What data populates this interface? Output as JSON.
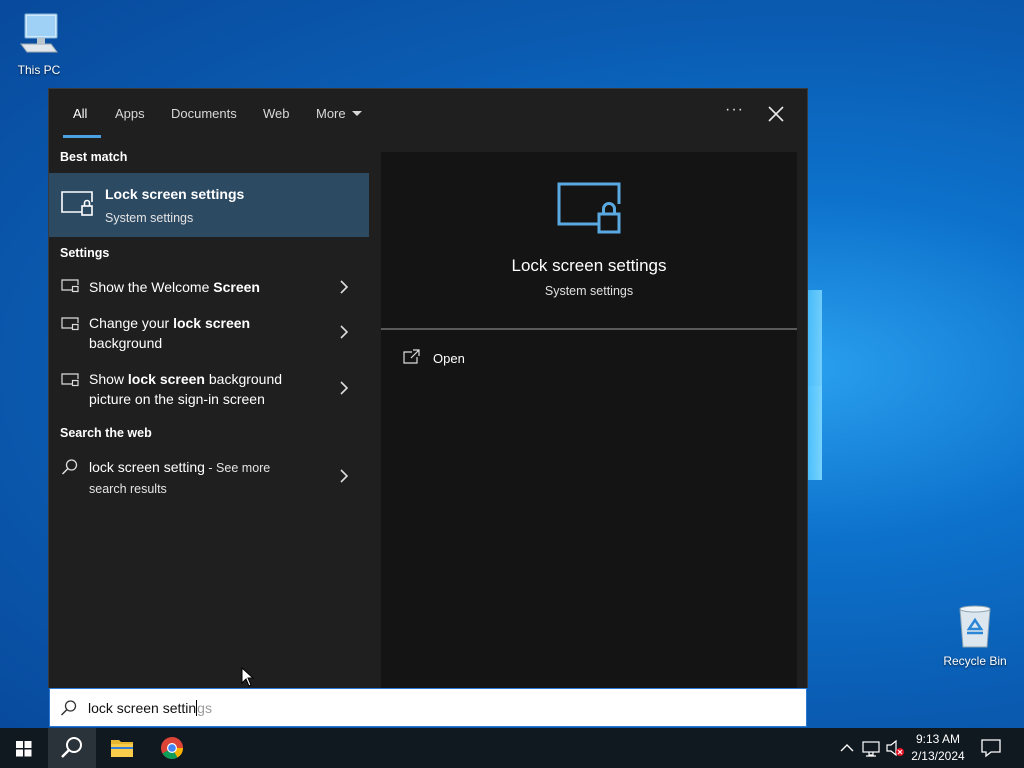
{
  "desktop": {
    "this_pc_label": "This PC",
    "recycle_bin_label": "Recycle Bin"
  },
  "search": {
    "tabs": [
      {
        "label": "All",
        "active": true
      },
      {
        "label": "Apps"
      },
      {
        "label": "Documents"
      },
      {
        "label": "Web"
      },
      {
        "label": "More"
      }
    ],
    "more_options_label": "···",
    "sections": {
      "best_match": "Best match",
      "settings": "Settings",
      "search_the_web": "Search the web"
    },
    "best_match": {
      "title": "Lock screen settings",
      "subtitle": "System settings"
    },
    "settings_results": [
      {
        "pre": "Show the Welcome ",
        "hl": "Screen",
        "post": ""
      },
      {
        "pre": "Change your ",
        "hl": "lock screen",
        "post": "",
        "line2": "background"
      },
      {
        "pre": "Show ",
        "hl": "lock screen",
        "post": " background",
        "line2": "picture on the sign-in screen"
      }
    ],
    "web_result": {
      "query": "lock screen setting",
      "suffix": " - See more",
      "line2": "search results"
    },
    "preview": {
      "title": "Lock screen settings",
      "subtitle": "System settings",
      "open_label": "Open"
    },
    "input": {
      "typed": "lock screen settin",
      "suggestion": "gs"
    }
  },
  "taskbar": {
    "time": "9:13 AM",
    "date": "2/13/2024"
  },
  "colors": {
    "accent": "#4aa2e0",
    "selected_row": "#2d4a63",
    "panel_bg": "#1f1f1f",
    "preview_bg": "#141414",
    "taskbar_bg": "#101820"
  }
}
